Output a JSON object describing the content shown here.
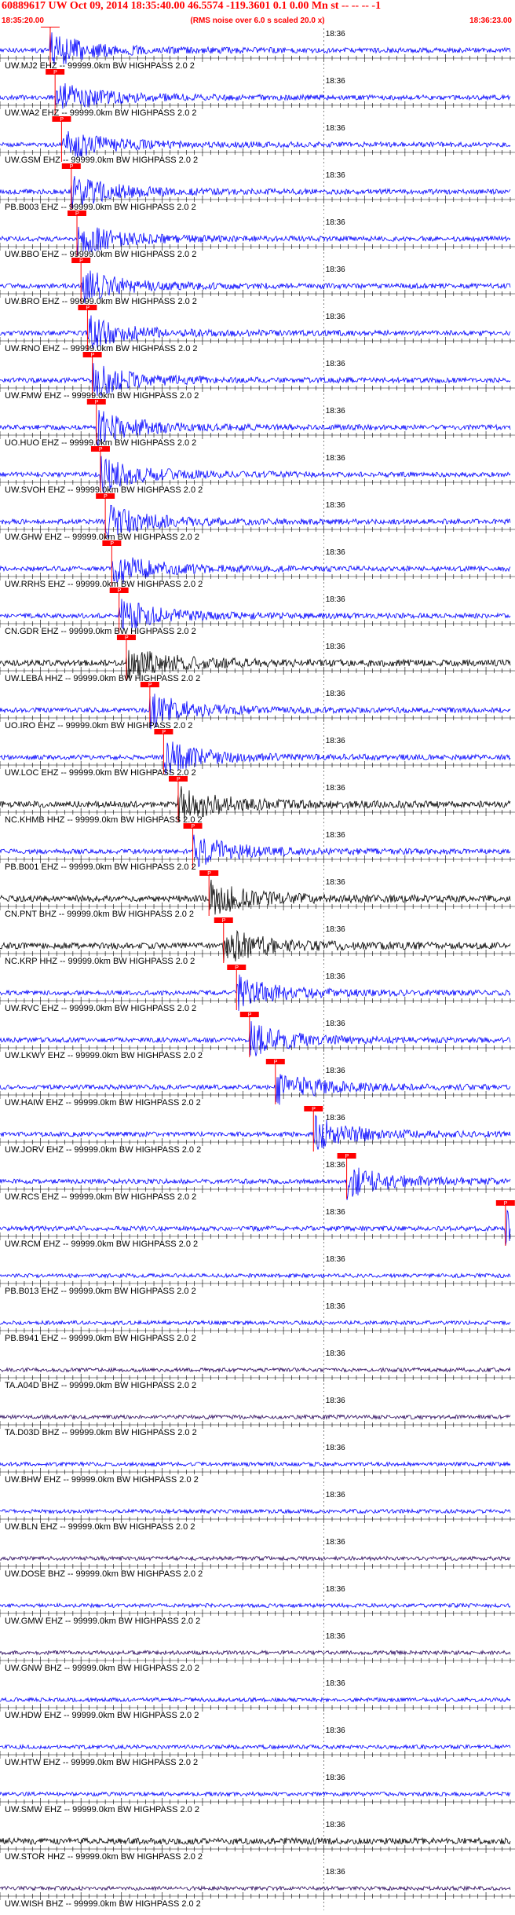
{
  "header": {
    "title": "60889617 UW Oct 09, 2014 18:35:40.00   46.5574 -119.3601  0.1 0.00 Mn st -- -- --  -1",
    "start_time": "18:35:20.00",
    "rms_note": "(RMS noise over 6.0 s scaled 20.0 x)",
    "end_time": "18:36:23.00"
  },
  "minute_label": "18:36",
  "colors": {
    "blue": "#0000ff",
    "black": "#000000",
    "purple": "#2b0a5e",
    "pick": "#ff0000"
  },
  "traces": [
    {
      "label": "UW.MJ2 EHZ -- 99999.0km BW  HIGHPASS  2.0  2",
      "color": "blue",
      "pick": "P"
    },
    {
      "label": "UW.WA2 EHZ -- 99999.0km BW  HIGHPASS  2.0  2",
      "color": "blue",
      "pick": "P"
    },
    {
      "label": "UW.GSM EHZ -- 99999.0km BW  HIGHPASS  2.0  2",
      "color": "blue",
      "pick": "P"
    },
    {
      "label": "PB.B003 EHZ -- 99999.0km BW  HIGHPASS  2.0  2",
      "color": "blue",
      "pick": "P"
    },
    {
      "label": "UW.BBO EHZ -- 99999.0km BW  HIGHPASS  2.0  2",
      "color": "blue",
      "pick": "P"
    },
    {
      "label": "UW.BRO EHZ -- 99999.0km BW  HIGHPASS  2.0  2",
      "color": "blue",
      "pick": "P"
    },
    {
      "label": "UW.RNO EHZ -- 99999.0km BW  HIGHPASS  2.0  2",
      "color": "blue",
      "pick": "P"
    },
    {
      "label": "UW.FMW EHZ -- 99999.0km BW  HIGHPASS  2.0  2",
      "color": "blue",
      "pick": "P"
    },
    {
      "label": "UO.HUO EHZ -- 99999.0km BW  HIGHPASS  2.0  2",
      "color": "blue",
      "pick": "P"
    },
    {
      "label": "UW.SVOH EHZ -- 99999.0km BW  HIGHPASS  2.0  2",
      "color": "blue",
      "pick": "P"
    },
    {
      "label": "UW.GHW EHZ -- 99999.0km BW  HIGHPASS  2.0  2",
      "color": "blue",
      "pick": "P"
    },
    {
      "label": "UW.RRHS EHZ -- 99999.0km BW  HIGHPASS  2.0  2",
      "color": "blue",
      "pick": "P"
    },
    {
      "label": "CN.GDR EHZ -- 99999.0km BW  HIGHPASS  2.0  2",
      "color": "blue",
      "pick": "P"
    },
    {
      "label": "UW.LEBA HHZ -- 99999.0km BW  HIGHPASS  2.0  2",
      "color": "black",
      "pick": "P"
    },
    {
      "label": "UO.IRO EHZ -- 99999.0km BW  HIGHPASS  2.0  2",
      "color": "blue",
      "pick": "P"
    },
    {
      "label": "UW.LOC EHZ -- 99999.0km BW  HIGHPASS  2.0  2",
      "color": "blue",
      "pick": "P"
    },
    {
      "label": "NC.KHMB HHZ -- 99999.0km BW  HIGHPASS  2.0  2",
      "color": "black",
      "pick": "P"
    },
    {
      "label": "PB.B001 EHZ -- 99999.0km BW  HIGHPASS  2.0  2",
      "color": "blue",
      "pick": "P"
    },
    {
      "label": "CN.PNT BHZ -- 99999.0km BW  HIGHPASS  2.0  2",
      "color": "black",
      "pick": "P"
    },
    {
      "label": "NC.KRP HHZ -- 99999.0km BW  HIGHPASS  2.0  2",
      "color": "black",
      "pick": "P"
    },
    {
      "label": "UW.RVC EHZ -- 99999.0km BW  HIGHPASS  2.0  2",
      "color": "blue",
      "pick": "P"
    },
    {
      "label": "UW.LKWY EHZ -- 99999.0km BW  HIGHPASS  2.0  2",
      "color": "blue",
      "pick": "P"
    },
    {
      "label": "UW.HAIW EHZ -- 99999.0km BW  HIGHPASS  2.0  2",
      "color": "blue",
      "pick": "P"
    },
    {
      "label": "UW.JORV EHZ -- 99999.0km BW  HIGHPASS  2.0  2",
      "color": "blue",
      "pick": "P"
    },
    {
      "label": "UW.RCS EHZ -- 99999.0km BW  HIGHPASS  2.0  2",
      "color": "blue",
      "pick": "P"
    },
    {
      "label": "UW.RCM EHZ -- 99999.0km BW  HIGHPASS  2.0  2",
      "color": "blue",
      "pick": "P"
    },
    {
      "label": "PB.B013 EHZ -- 99999.0km BW  HIGHPASS  2.0  2",
      "color": "blue",
      "pick": ""
    },
    {
      "label": "PB.B941 EHZ -- 99999.0km BW  HIGHPASS  2.0  2",
      "color": "blue",
      "pick": ""
    },
    {
      "label": "TA.A04D BHZ -- 99999.0km BW  HIGHPASS  2.0  2",
      "color": "purple",
      "pick": ""
    },
    {
      "label": "TA.D03D BHZ -- 99999.0km BW  HIGHPASS  2.0  2",
      "color": "purple",
      "pick": ""
    },
    {
      "label": "UW.BHW EHZ -- 99999.0km BW  HIGHPASS  2.0  2",
      "color": "blue",
      "pick": ""
    },
    {
      "label": "UW.BLN EHZ -- 99999.0km BW  HIGHPASS  2.0  2",
      "color": "blue",
      "pick": ""
    },
    {
      "label": "UW.DOSE BHZ -- 99999.0km BW  HIGHPASS  2.0  2",
      "color": "purple",
      "pick": ""
    },
    {
      "label": "UW.GMW EHZ -- 99999.0km BW  HIGHPASS  2.0  2",
      "color": "blue",
      "pick": ""
    },
    {
      "label": "UW.GNW BHZ -- 99999.0km BW  HIGHPASS  2.0  2",
      "color": "purple",
      "pick": ""
    },
    {
      "label": "UW.HDW EHZ -- 99999.0km BW  HIGHPASS  2.0  2",
      "color": "blue",
      "pick": ""
    },
    {
      "label": "UW.HTW EHZ -- 99999.0km BW  HIGHPASS  2.0  2",
      "color": "blue",
      "pick": ""
    },
    {
      "label": "UW.SMW EHZ -- 99999.0km BW  HIGHPASS  2.0  2",
      "color": "blue",
      "pick": ""
    },
    {
      "label": "UW.STOR HHZ -- 99999.0km BW  HIGHPASS  2.0  2",
      "color": "black",
      "pick": ""
    },
    {
      "label": "UW.WISH BHZ -- 99999.0km BW  HIGHPASS  2.0  2",
      "color": "purple",
      "pick": ""
    }
  ]
}
